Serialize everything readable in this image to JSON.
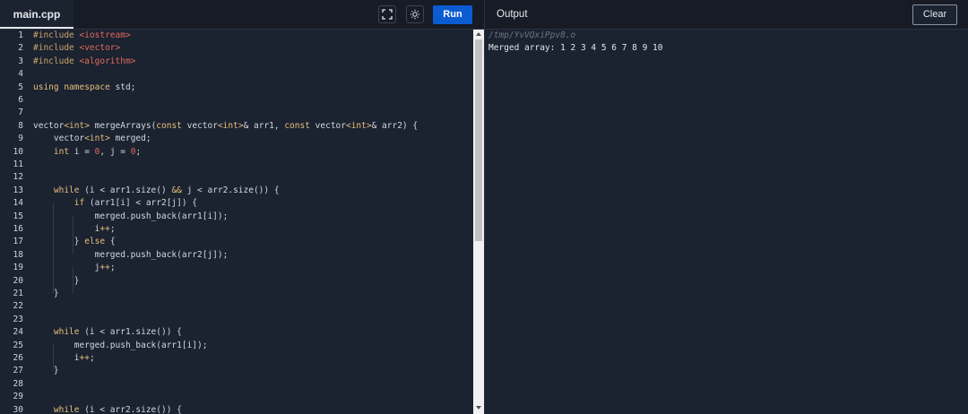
{
  "editor": {
    "tab_label": "main.cpp",
    "run_label": "Run",
    "lines": [
      {
        "n": "1",
        "tokens": [
          [
            "dir",
            "#include "
          ],
          [
            "str",
            "<iostream>"
          ]
        ]
      },
      {
        "n": "2",
        "tokens": [
          [
            "dir",
            "#include "
          ],
          [
            "str",
            "<vector>"
          ]
        ]
      },
      {
        "n": "3",
        "tokens": [
          [
            "dir",
            "#include "
          ],
          [
            "str",
            "<algorithm>"
          ]
        ]
      },
      {
        "n": "4",
        "tokens": []
      },
      {
        "n": "5",
        "tokens": [
          [
            "kw",
            "using namespace"
          ],
          [
            "",
            " std;"
          ]
        ]
      },
      {
        "n": "6",
        "tokens": []
      },
      {
        "n": "7",
        "tokens": []
      },
      {
        "n": "8",
        "tokens": [
          [
            "",
            "vector"
          ],
          [
            "kw",
            "<int>"
          ],
          [
            "",
            " mergeArrays("
          ],
          [
            "kw",
            "const"
          ],
          [
            "",
            " vector"
          ],
          [
            "kw",
            "<int>"
          ],
          [
            "",
            "& arr1, "
          ],
          [
            "kw",
            "const"
          ],
          [
            "",
            " vector"
          ],
          [
            "kw",
            "<int>"
          ],
          [
            "",
            "& arr2) {"
          ]
        ]
      },
      {
        "n": "9",
        "tokens": [
          [
            "",
            "    vector"
          ],
          [
            "kw",
            "<int>"
          ],
          [
            "",
            " merged;"
          ]
        ]
      },
      {
        "n": "10",
        "tokens": [
          [
            "kw",
            "    int"
          ],
          [
            "",
            " i = "
          ],
          [
            "num",
            "0"
          ],
          [
            "",
            ", j = "
          ],
          [
            "num",
            "0"
          ],
          [
            "",
            ";"
          ]
        ]
      },
      {
        "n": "11",
        "tokens": []
      },
      {
        "n": "12",
        "tokens": []
      },
      {
        "n": "13",
        "tokens": [
          [
            "kw",
            "    while"
          ],
          [
            "",
            " (i < arr1.size() "
          ],
          [
            "kw",
            "&&"
          ],
          [
            "",
            " j < arr2.size()) {"
          ]
        ]
      },
      {
        "n": "14",
        "tokens": [
          [
            "kw",
            "        if"
          ],
          [
            "",
            " (arr1[i] < arr2[j]) {"
          ]
        ]
      },
      {
        "n": "15",
        "tokens": [
          [
            "",
            "            merged.push_back(arr1[i]);"
          ]
        ]
      },
      {
        "n": "16",
        "tokens": [
          [
            "",
            "            i"
          ],
          [
            "kw",
            "++"
          ],
          [
            "",
            ";"
          ]
        ]
      },
      {
        "n": "17",
        "tokens": [
          [
            "",
            "        } "
          ],
          [
            "kw",
            "else"
          ],
          [
            "",
            " {"
          ]
        ]
      },
      {
        "n": "18",
        "tokens": [
          [
            "",
            "            merged.push_back(arr2[j]);"
          ]
        ]
      },
      {
        "n": "19",
        "tokens": [
          [
            "",
            "            j"
          ],
          [
            "kw",
            "++"
          ],
          [
            "",
            ";"
          ]
        ]
      },
      {
        "n": "20",
        "tokens": [
          [
            "",
            "        }"
          ]
        ]
      },
      {
        "n": "21",
        "tokens": [
          [
            "",
            "    }"
          ]
        ]
      },
      {
        "n": "22",
        "tokens": []
      },
      {
        "n": "23",
        "tokens": []
      },
      {
        "n": "24",
        "tokens": [
          [
            "kw",
            "    while"
          ],
          [
            "",
            " (i < arr1.size()) {"
          ]
        ]
      },
      {
        "n": "25",
        "tokens": [
          [
            "",
            "        merged.push_back(arr1[i]);"
          ]
        ]
      },
      {
        "n": "26",
        "tokens": [
          [
            "",
            "        i"
          ],
          [
            "kw",
            "++"
          ],
          [
            "",
            ";"
          ]
        ]
      },
      {
        "n": "27",
        "tokens": [
          [
            "",
            "    }"
          ]
        ]
      },
      {
        "n": "28",
        "tokens": []
      },
      {
        "n": "29",
        "tokens": []
      },
      {
        "n": "30",
        "tokens": [
          [
            "kw",
            "    while"
          ],
          [
            "",
            " (i < arr2.size()) {"
          ]
        ]
      }
    ]
  },
  "output": {
    "title": "Output",
    "clear_label": "Clear",
    "path": "/tmp/YvVQxiPpv8.o",
    "text": "Merged array: 1 2 3 4 5 6 7 8 9 10"
  },
  "icons": {
    "fullscreen": "fullscreen-icon",
    "theme": "sun-icon"
  }
}
